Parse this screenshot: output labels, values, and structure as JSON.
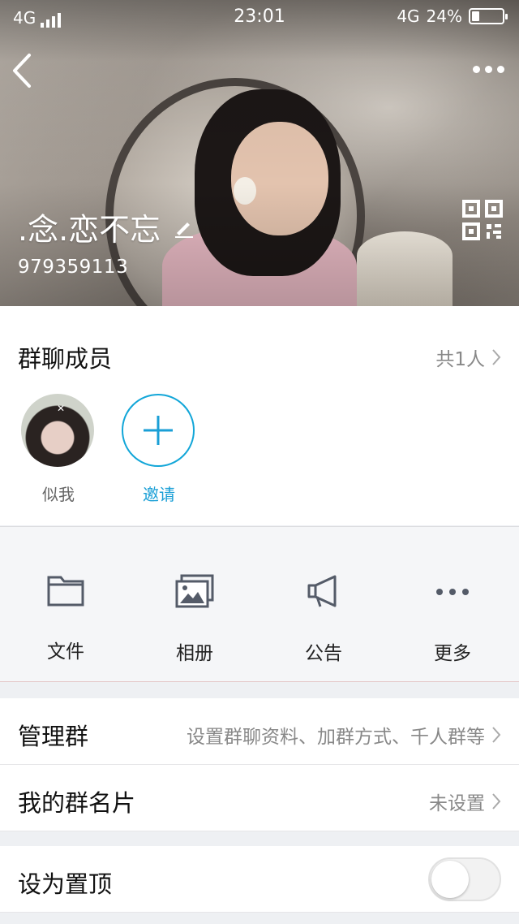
{
  "status_bar": {
    "network_left": "4G",
    "time": "23:01",
    "network_right": "4G",
    "battery_text": "24%",
    "battery_level": 0.24
  },
  "header": {
    "group_name": ".念.恋不忘",
    "group_id": "979359113"
  },
  "members": {
    "title": "群聊成员",
    "count": "共1人",
    "list": [
      {
        "name": "似我"
      }
    ],
    "invite_label": "邀请"
  },
  "tools": [
    {
      "label": "文件",
      "icon": "folder-icon"
    },
    {
      "label": "相册",
      "icon": "album-icon"
    },
    {
      "label": "公告",
      "icon": "megaphone-icon"
    },
    {
      "label": "更多",
      "icon": "more-dots-icon"
    }
  ],
  "settings": {
    "manage": {
      "label": "管理群",
      "value": "设置群聊资料、加群方式、千人群等"
    },
    "card": {
      "label": "我的群名片",
      "value": "未设置"
    },
    "pin": {
      "label": "设为置顶",
      "on": false
    }
  },
  "colors": {
    "accent": "#1a9fd6"
  }
}
